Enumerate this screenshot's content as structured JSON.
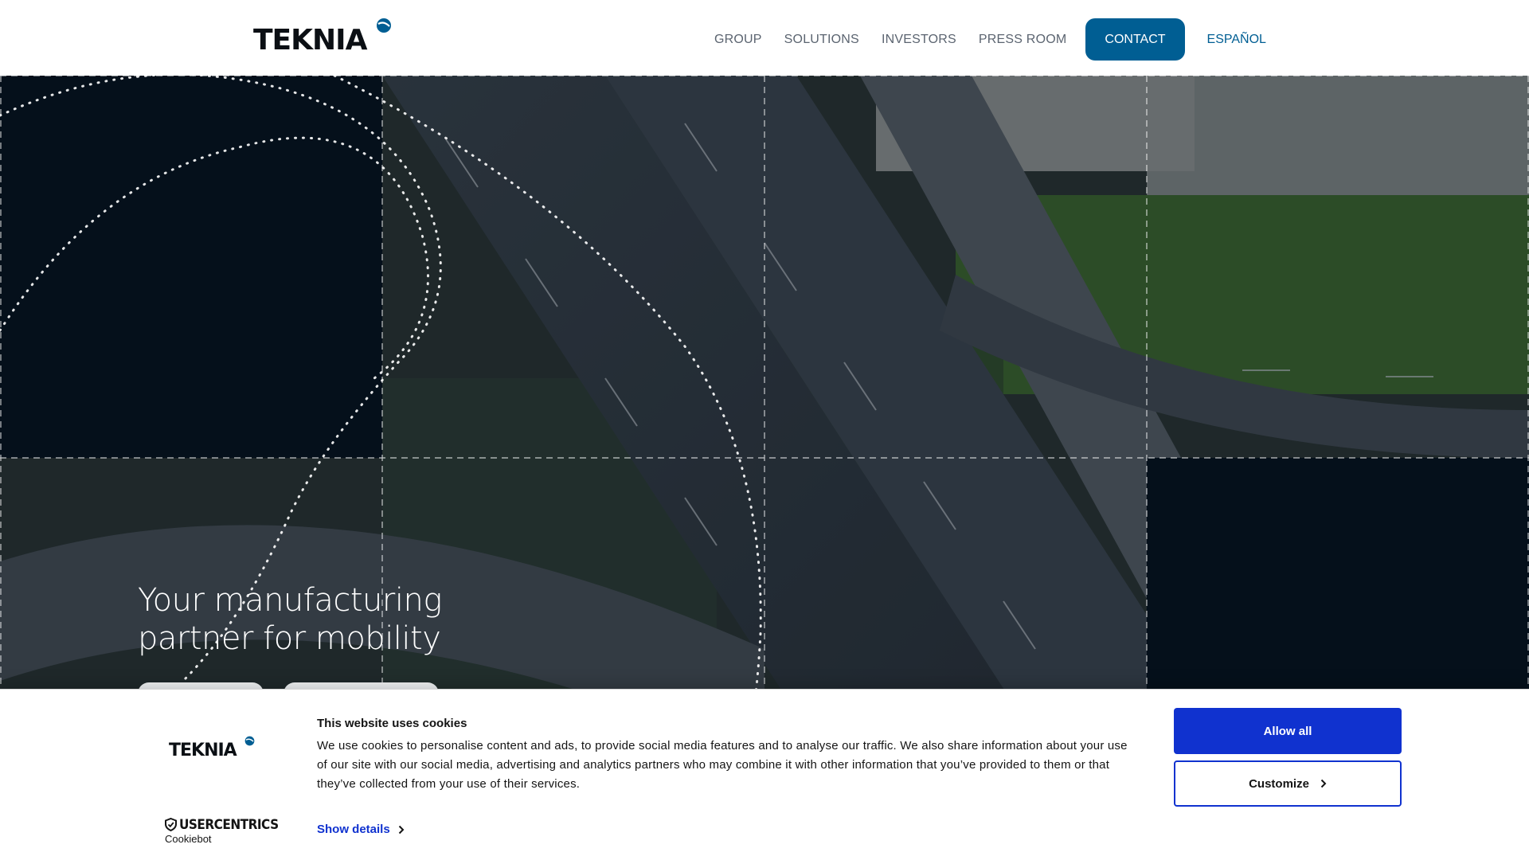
{
  "header": {
    "logo_text": "TEKNIA",
    "nav": {
      "group": "GROUP",
      "solutions": "SOLUTIONS",
      "investors": "INVESTORS",
      "press_room": "PRESS ROOM",
      "contact": "CONTACT",
      "language": "ESPAÑOL"
    }
  },
  "hero": {
    "title_line1": "Your manufacturing",
    "title_line2": "partner for mobility"
  },
  "cookie_banner": {
    "logo_text": "TEKNIA",
    "title": "This website uses cookies",
    "body": "We use cookies to personalise content and ads, to provide social media features and to analyse our traffic. We also share information about your use of our site with our social media, advertising and analytics partners who may combine it with other information that you’ve provided to them or that they’ve collected from your use of their services.",
    "show_details": "Show details",
    "allow_all": "Allow all",
    "customize": "Customize",
    "brand_name": "USERCENTRICS",
    "brand_sub": "Cookiebot"
  },
  "colors": {
    "brand_blue": "#005e93",
    "hero_dark": "#05101b",
    "cookie_blue": "#1032cf"
  },
  "icons": [
    "logo-dot-icon",
    "chevron-right-icon",
    "shield-icon"
  ]
}
